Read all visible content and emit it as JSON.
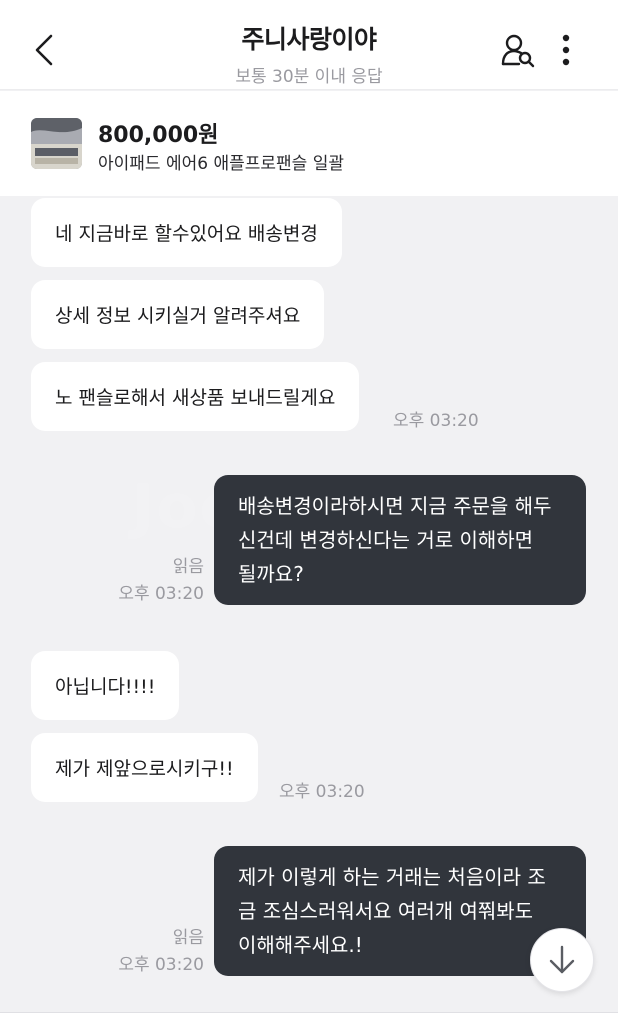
{
  "header": {
    "title": "주니사랑이야",
    "subtitle": "보통 30분 이내 응답",
    "icons": {
      "back": "chevron-left-icon",
      "profile_search": "user-search-icon",
      "more": "more-vertical-icon"
    }
  },
  "product": {
    "price": "800,000원",
    "title": "아이패드 에어6 애플프로팬슬 일괄",
    "thumbnail": "ipad-thumbnail"
  },
  "watermark": "Joonggonara",
  "messages": [
    {
      "side": "in",
      "text": "네 지금바로 할수있어요 배송변경"
    },
    {
      "side": "in",
      "text": "상세 정보 시키실거 알려주셔요"
    },
    {
      "side": "in",
      "text": "노 팬슬로해서 새상품 보내드릴게요",
      "time": "오후 03:20"
    },
    {
      "side": "out",
      "lines": [
        "배송변경이라하시면 지금 주문을 해두",
        "신건데 변경하신다는 거로 이해하면",
        "될까요?"
      ],
      "read": "읽음",
      "time": "오후 03:20"
    },
    {
      "side": "in",
      "text": "아닙니다!!!!"
    },
    {
      "side": "in",
      "text": "제가 제앞으로시키구!!",
      "time": "오후 03:20"
    },
    {
      "side": "out",
      "lines": [
        "제가 이렇게 하는 거래는 처음이라 조",
        "금 조심스러워서요 여러개 여쭤봐도",
        "이해해주세요.!"
      ],
      "read": "읽음",
      "time": "오후 03:20"
    }
  ],
  "scroll_down_icon": "arrow-down-icon",
  "colors": {
    "incoming_bubble": "#ffffff",
    "outgoing_bubble": "#31353c",
    "background": "#f1f1f3",
    "muted_text": "#9a9aa0"
  }
}
